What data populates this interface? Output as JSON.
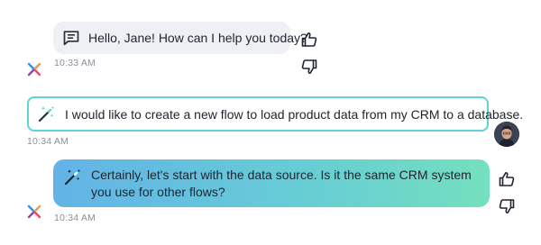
{
  "messages": {
    "assistant_greeting": {
      "text": "Hello, Jane! How can I help you today?",
      "timestamp": "10:33 AM",
      "icon": "chat-bubble-icon"
    },
    "user_request": {
      "text": "I would like to create a new flow to load product data from my CRM to a database.",
      "timestamp": "10:34 AM",
      "icon": "magic-wand-icon"
    },
    "assistant_reply": {
      "text": "Certainly, let's start with the data source. Is it the same CRM system you use for other flows?",
      "timestamp": "10:34 AM",
      "icon": "magic-wand-icon"
    }
  },
  "colors": {
    "assistant_bubble": "#eef0f4",
    "user_border": "#5fd3d6",
    "reply_gradient_start": "#63b3e6",
    "reply_gradient_end": "#74e0be",
    "timestamp": "#8a8f99"
  }
}
